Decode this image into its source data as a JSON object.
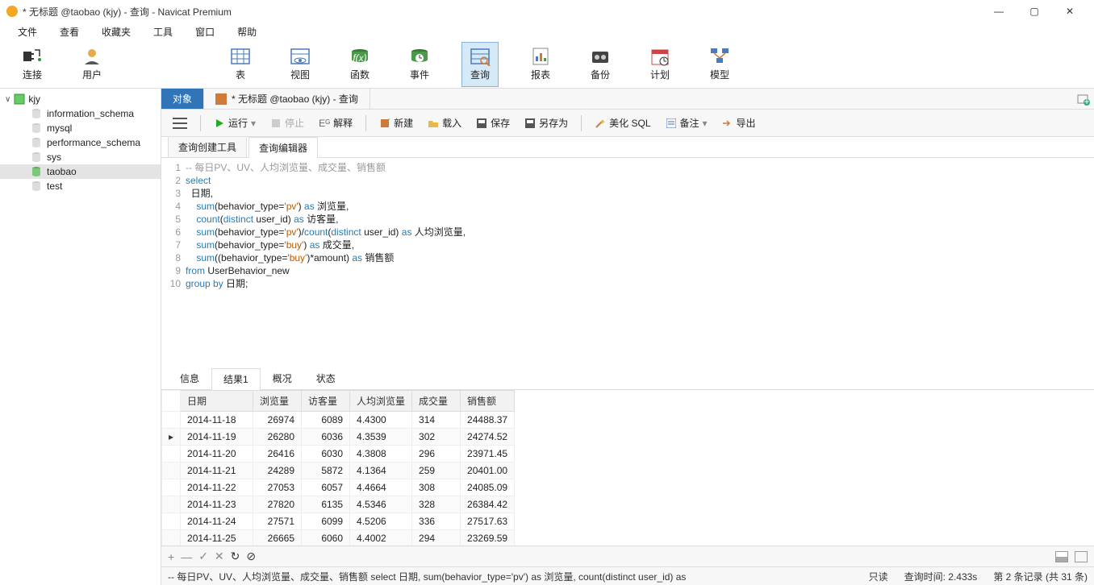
{
  "window": {
    "title": "* 无标题 @taobao (kjy) - 查询 - Navicat Premium"
  },
  "menu": {
    "items": [
      "文件",
      "查看",
      "收藏夹",
      "工具",
      "窗口",
      "帮助"
    ]
  },
  "ribbon": {
    "items": [
      {
        "label": "连接",
        "icon": "plug"
      },
      {
        "label": "用户",
        "icon": "user"
      },
      {
        "label": "表",
        "icon": "table"
      },
      {
        "label": "视图",
        "icon": "view"
      },
      {
        "label": "函数",
        "icon": "function"
      },
      {
        "label": "事件",
        "icon": "event"
      },
      {
        "label": "查询",
        "icon": "query",
        "active": true
      },
      {
        "label": "报表",
        "icon": "report"
      },
      {
        "label": "备份",
        "icon": "backup"
      },
      {
        "label": "计划",
        "icon": "schedule"
      },
      {
        "label": "模型",
        "icon": "model"
      }
    ]
  },
  "sidebar": {
    "connection": "kjy",
    "databases": [
      {
        "name": "information_schema"
      },
      {
        "name": "mysql"
      },
      {
        "name": "performance_schema"
      },
      {
        "name": "sys"
      },
      {
        "name": "taobao",
        "active": true
      },
      {
        "name": "test"
      }
    ]
  },
  "tabs": {
    "obj": "对象",
    "query": "* 无标题 @taobao (kjy) - 查询"
  },
  "toolbar": {
    "run": "运行",
    "stop": "停止",
    "explain": "解释",
    "new": "新建",
    "load": "载入",
    "save": "保存",
    "saveas": "另存为",
    "beautify": "美化 SQL",
    "note": "备注",
    "export": "导出"
  },
  "query_tabs": {
    "builder": "查询创建工具",
    "editor": "查询编辑器"
  },
  "sql": {
    "lines": [
      "-- 每日PV、UV、人均浏览量、成交量、销售额",
      "select",
      "  日期,",
      "    sum(behavior_type='pv') as 浏览量,",
      "    count(distinct user_id) as 访客量,",
      "    sum(behavior_type='pv')/count(distinct user_id) as 人均浏览量,",
      "    sum(behavior_type='buy') as 成交量,",
      "    sum((behavior_type='buy')*amount) as 销售额",
      "from UserBehavior_new",
      "group by 日期;"
    ]
  },
  "result_tabs": {
    "info": "信息",
    "result": "结果1",
    "profile": "概况",
    "status": "状态"
  },
  "grid": {
    "columns": [
      "日期",
      "浏览量",
      "访客量",
      "人均浏览量",
      "成交量",
      "销售额"
    ],
    "rows": [
      [
        "2014-11-18",
        "26974",
        "6089",
        "4.4300",
        "314",
        "24488.37"
      ],
      [
        "2014-11-19",
        "26280",
        "6036",
        "4.3539",
        "302",
        "24274.52"
      ],
      [
        "2014-11-20",
        "26416",
        "6030",
        "4.3808",
        "296",
        "23971.45"
      ],
      [
        "2014-11-21",
        "24289",
        "5872",
        "4.1364",
        "259",
        "20401.00"
      ],
      [
        "2014-11-22",
        "27053",
        "6057",
        "4.4664",
        "308",
        "24085.09"
      ],
      [
        "2014-11-23",
        "27820",
        "6135",
        "4.5346",
        "328",
        "26384.42"
      ],
      [
        "2014-11-24",
        "27571",
        "6099",
        "4.5206",
        "336",
        "27517.63"
      ],
      [
        "2014-11-25",
        "26665",
        "6060",
        "4.4002",
        "294",
        "23269.59"
      ]
    ],
    "current_row": 1
  },
  "status": {
    "sql_preview": "-- 每日PV、UV、人均浏览量、成交量、销售额 select         日期,     sum(behavior_type='pv') as 浏览量,     count(distinct user_id) as",
    "readonly": "只读",
    "time": "查询时间: 2.433s",
    "records": "第 2 条记录 (共 31 条)"
  }
}
